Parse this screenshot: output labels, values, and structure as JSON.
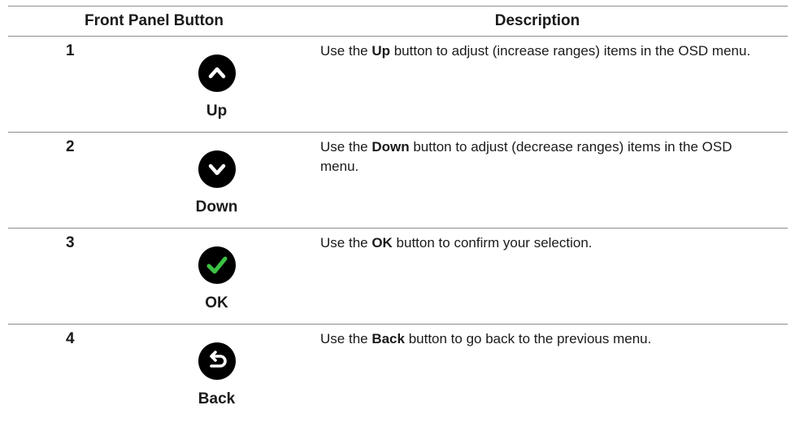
{
  "header": {
    "col_button": "Front Panel Button",
    "col_description": "Description"
  },
  "rows": [
    {
      "number": "1",
      "icon": "chevron-up-icon",
      "label": "Up",
      "desc_pre": "Use the ",
      "desc_bold": "Up",
      "desc_post": " button to adjust (increase ranges) items in the OSD menu."
    },
    {
      "number": "2",
      "icon": "chevron-down-icon",
      "label": "Down",
      "desc_pre": "Use the ",
      "desc_bold": "Down",
      "desc_post": " button to adjust (decrease ranges) items in the OSD menu."
    },
    {
      "number": "3",
      "icon": "checkmark-icon",
      "label": "OK",
      "desc_pre": "Use the ",
      "desc_bold": "OK",
      "desc_post": " button to confirm your selection."
    },
    {
      "number": "4",
      "icon": "back-arrow-icon",
      "label": "Back",
      "desc_pre": "Use the ",
      "desc_bold": "Back",
      "desc_post": " button to go back to the previous menu."
    }
  ],
  "colors": {
    "icon_fill": "#000000",
    "icon_glyph": "#ffffff",
    "ok_check": "#3cc243",
    "rule": "#8c8c8c"
  }
}
